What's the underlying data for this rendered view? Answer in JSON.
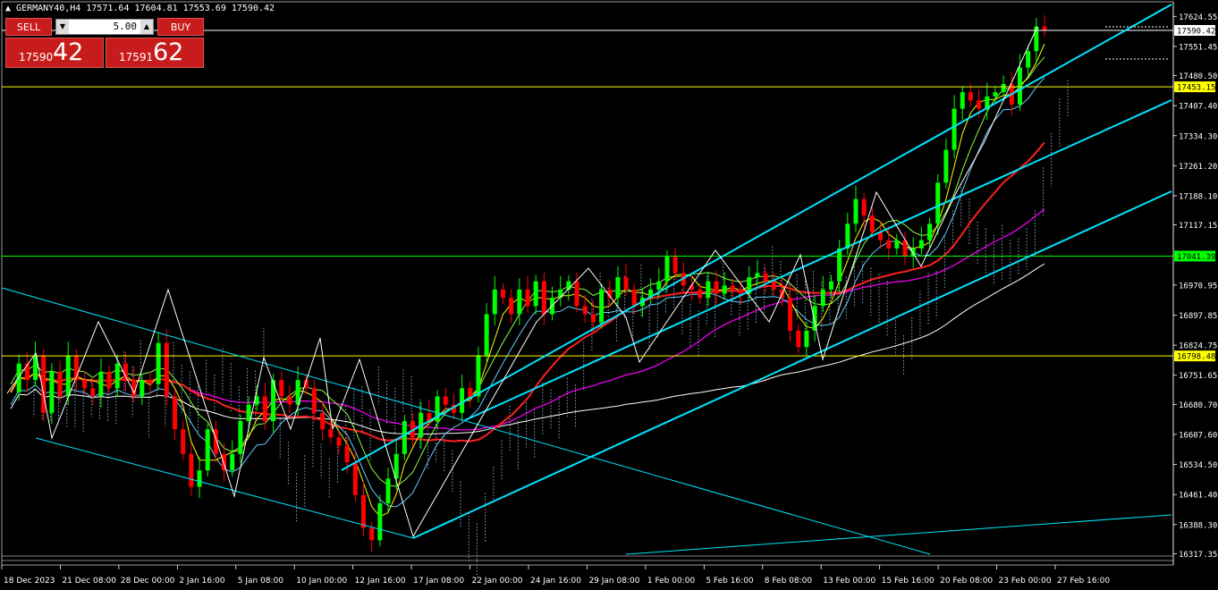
{
  "header": {
    "title": "GERMANY40,H4  17571.64 17604.81 17553.69 17590.42"
  },
  "trade_panel": {
    "sell_label": "SELL",
    "buy_label": "BUY",
    "lot_value": "5.00",
    "sell_price_small": "17590",
    "sell_price_big": "42",
    "buy_price_small": "17591",
    "buy_price_big": "62",
    "color": "#c81c1c"
  },
  "chart_data": {
    "type": "candlestick",
    "symbol": "GERMANY40",
    "timeframe": "H4",
    "ohlc_last": {
      "open": 17571.64,
      "high": 17604.81,
      "low": 17553.69,
      "close": 17590.42
    },
    "ylim": [
      16290,
      17660
    ],
    "y_ticks": [
      17624.55,
      17551.45,
      17480.5,
      17407.4,
      17334.3,
      17261.2,
      17188.1,
      17117.15,
      16970.95,
      16897.85,
      16824.75,
      16751.65,
      16680.7,
      16607.6,
      16534.5,
      16461.4,
      16388.3,
      16317.35
    ],
    "x_tick_labels": [
      "18 Dec 2023",
      "21 Dec 08:00",
      "28 Dec 00:00",
      "2 Jan 16:00",
      "5 Jan 08:00",
      "10 Jan 00:00",
      "12 Jan 16:00",
      "17 Jan 08:00",
      "22 Jan 00:00",
      "24 Jan 16:00",
      "29 Jan 08:00",
      "1 Feb 00:00",
      "5 Feb 16:00",
      "8 Feb 08:00",
      "13 Feb 00:00",
      "15 Feb 16:00",
      "20 Feb 08:00",
      "23 Feb 00:00",
      "27 Feb 16:00"
    ],
    "horizontal_levels": [
      {
        "value": 17590.42,
        "label": "17590.42",
        "color": "#ffffff"
      },
      {
        "value": 17453.15,
        "label": "17453.15",
        "color": "#ffff00"
      },
      {
        "value": 17041.39,
        "label": "17041.39",
        "color": "#00ff00"
      },
      {
        "value": 16798.48,
        "label": "16798.48",
        "color": "#ffff00"
      }
    ],
    "price_path": [
      16710,
      16780,
      16740,
      16800,
      16660,
      16760,
      16700,
      16800,
      16740,
      16720,
      16700,
      16760,
      16720,
      16780,
      16740,
      16700,
      16740,
      16730,
      16830,
      16700,
      16620,
      16560,
      16480,
      16520,
      16620,
      16560,
      16520,
      16560,
      16640,
      16680,
      16700,
      16640,
      16740,
      16700,
      16680,
      16740,
      16720,
      16660,
      16620,
      16600,
      16580,
      16540,
      16460,
      16380,
      16350,
      16440,
      16500,
      16560,
      16640,
      16600,
      16660,
      16640,
      16700,
      16680,
      16660,
      16720,
      16700,
      16800,
      16900,
      16960,
      16940,
      16900,
      16960,
      16920,
      16980,
      16900,
      16940,
      16960,
      16980,
      16920,
      16900,
      16880,
      16960,
      16940,
      16990,
      16960,
      16920,
      16940,
      16960,
      16980,
      17040,
      17000,
      16970,
      16960,
      16940,
      16980,
      16950,
      16970,
      16960,
      16950,
      16990,
      17000,
      16980,
      16960,
      16940,
      16860,
      16820,
      16860,
      16920,
      16960,
      16980,
      17060,
      17120,
      17180,
      17140,
      17100,
      17080,
      17060,
      17080,
      17040,
      17060,
      17080,
      17120,
      17220,
      17300,
      17400,
      17440,
      17420,
      17400,
      17430,
      17440,
      17460,
      17410,
      17500,
      17540,
      17600,
      17590
    ],
    "colors": {
      "bull": "#00ff00",
      "bear": "#ff0000",
      "channel": "#00e5ff",
      "ma_fast": "#ffff00",
      "ma_mid": "#ff2020",
      "ma_slow": "#ff00ff",
      "ma_long": "#ffffff"
    }
  }
}
